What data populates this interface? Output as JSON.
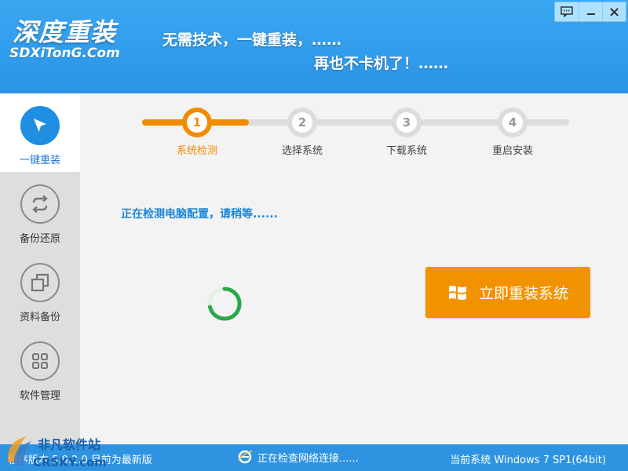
{
  "header": {
    "logo_main": "深度重装",
    "logo_sub": "SDXiTonG.Com",
    "slogan_1": "无需技术，一键重装，……",
    "slogan_2": "再也不卡机了！……"
  },
  "window_controls": {
    "feedback": "feedback-icon",
    "minimize": "minimize-icon",
    "close": "×"
  },
  "sidebar": {
    "items": [
      {
        "label": "一键重装",
        "icon": "cursor-arrow-icon",
        "active": true
      },
      {
        "label": "备份还原",
        "icon": "sync-arrows-icon",
        "active": false
      },
      {
        "label": "资料备份",
        "icon": "copy-icon",
        "active": false
      },
      {
        "label": "软件管理",
        "icon": "grid-icon",
        "active": false
      }
    ]
  },
  "steps": {
    "progress_fraction": 0.25,
    "items": [
      {
        "num": "1",
        "label": "系统检测",
        "done": true
      },
      {
        "num": "2",
        "label": "选择系统",
        "done": false
      },
      {
        "num": "3",
        "label": "下载系统",
        "done": false
      },
      {
        "num": "4",
        "label": "重启安装",
        "done": false
      }
    ]
  },
  "main": {
    "detect_text": "正在检测电脑配置，请稍等......",
    "reinstall_button": "立即重装系统"
  },
  "statusbar": {
    "version_text": "程序版本 5.0.2.0   目前为最新版",
    "network_text": "正在检查网络连接......",
    "system_text": "当前系统 Windows 7 SP1(64bit)"
  },
  "watermark": {
    "text_1": "非凡软件站",
    "text_2": "CRSKY.com"
  },
  "colors": {
    "header_blue": "#2a94e6",
    "accent_orange": "#f39200",
    "active_blue": "#1e8fe3",
    "status_blue": "#2e94e2",
    "spinner_green": "#2aa84a"
  }
}
